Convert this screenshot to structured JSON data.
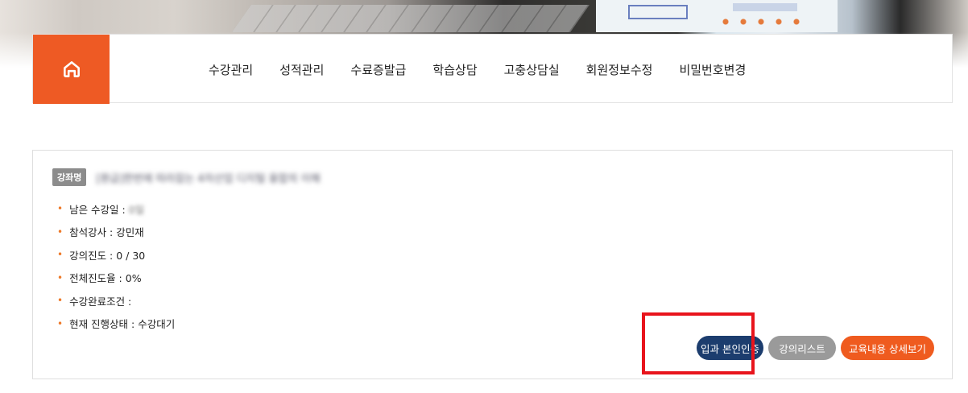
{
  "header": {
    "home_icon": "home-icon",
    "nav_items": [
      "수강관리",
      "성적관리",
      "수료증발급",
      "학습상담",
      "고충상담실",
      "회원정보수정",
      "비밀번호변경"
    ]
  },
  "course": {
    "badge": "강좌명",
    "name": "[환급]한번에 따라잡는 4차산업 디지털 융합의 이해",
    "info": [
      {
        "text": "남은 수강일 :",
        "blurred": "0일"
      },
      {
        "text": "참석강사 : 강민재",
        "blurred": ""
      },
      {
        "text": "강의진도 : 0 / 30",
        "blurred": ""
      },
      {
        "text": "전체진도율 : 0%",
        "blurred": ""
      },
      {
        "text": "수강완료조건 :",
        "blurred": ""
      },
      {
        "text": "현재 진행상태 : 수강대기",
        "blurred": ""
      }
    ],
    "buttons": {
      "verify": "입과 본인인증",
      "list": "강의리스트",
      "detail": "교육내용 상세보기"
    }
  },
  "colors": {
    "accent": "#ee5a24",
    "verify_button": "#1c3d6e",
    "list_button": "#9a9a9a",
    "highlight_box": "#e8141c"
  }
}
